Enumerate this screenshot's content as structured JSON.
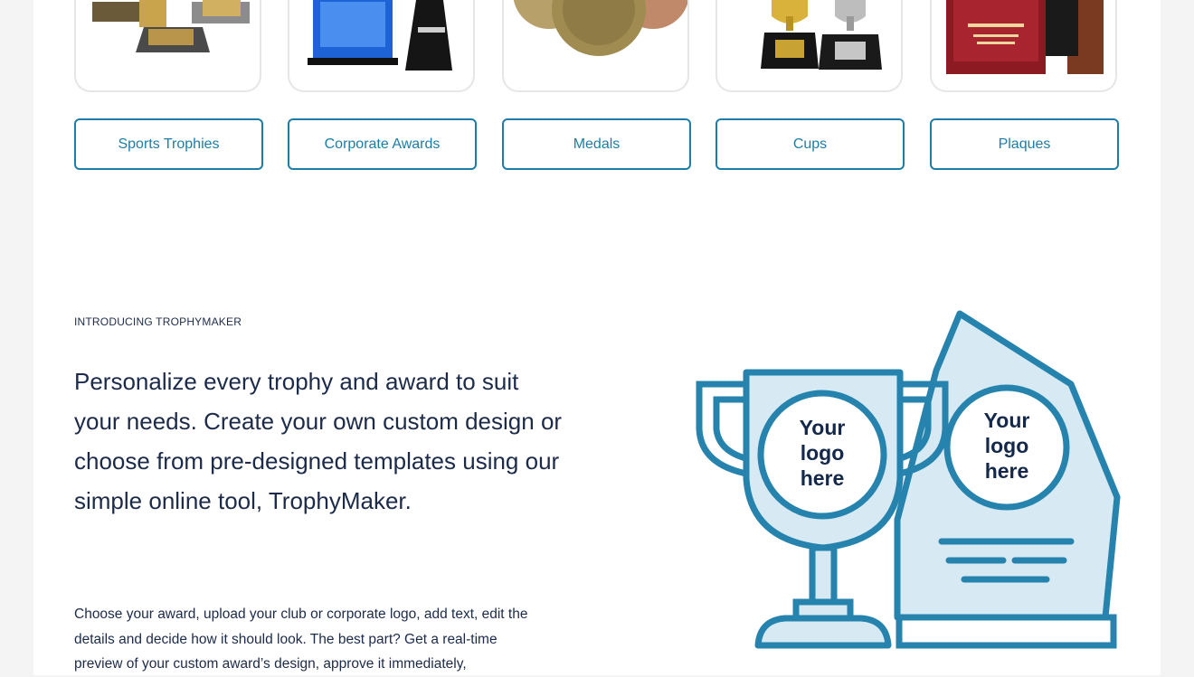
{
  "categories": [
    {
      "label": "Sports Trophies"
    },
    {
      "label": "Corporate Awards"
    },
    {
      "label": "Medals"
    },
    {
      "label": "Cups"
    },
    {
      "label": "Plaques"
    }
  ],
  "intro": {
    "eyebrow": "INTRODUCING TROPHYMAKER",
    "headline": "Personalize every trophy and award to suit your needs. Create your own custom design or choose from pre-designed templates using our simple online tool, TrophyMaker.",
    "body": "Choose your award, upload your club or corporate logo, add text, edit the details and decide how it should look. The best part? Get a real-time preview of your custom award’s design, approve it immediately,"
  },
  "illustration": {
    "cup_logo_text": [
      "Your",
      "logo",
      "here"
    ],
    "crystal_logo_text": [
      "Your",
      "logo",
      "here"
    ]
  },
  "colors": {
    "accent": "#1d7da6",
    "text": "#1c2b4a",
    "illus_fill": "#d7e9f2",
    "illus_stroke": "#2583ad"
  }
}
